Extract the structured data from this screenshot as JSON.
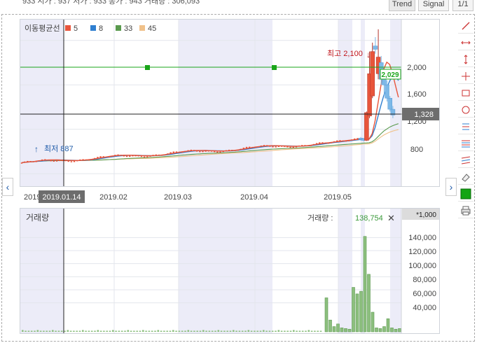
{
  "topbar": {
    "stats": "933   시가 : 937   저가 : 933   종가 : 943   거래량 : 306,093",
    "buttons": [
      "Trend",
      "Signal",
      "1/1"
    ]
  },
  "ma_legend": {
    "title": "이동평균선",
    "items": [
      {
        "label": "5",
        "color": "#e8553b"
      },
      {
        "label": "8",
        "color": "#2f7fd0"
      },
      {
        "label": "33",
        "color": "#5a9a4e"
      },
      {
        "label": "45",
        "color": "#f0c18a"
      }
    ]
  },
  "price_chart": {
    "high_label": "최고 2,100",
    "low_label": "최저 887",
    "current_price": "1,328",
    "green_flag": "2,029",
    "y_ticks": [
      "2,000",
      "1,600",
      "1,200",
      "800"
    ],
    "x_ticks": [
      "2019.0",
      "2019.02",
      "2019.03",
      "2019.04",
      "2019.05"
    ],
    "crosshair_date": "2019.01.14"
  },
  "volume_chart": {
    "title": "거래량",
    "readout_label": "거래량 :",
    "readout_value": "138,754",
    "close_symbol": "✕",
    "unit": "*1,000",
    "y_ticks": [
      "140,000",
      "120,000",
      "100,000",
      "80,000",
      "60,000",
      "40,000"
    ]
  },
  "nav": {
    "left": "‹",
    "right": "›"
  },
  "tools": [
    "line-tool",
    "horizontal-range-tool",
    "vertical-range-tool",
    "crosshair-tool",
    "rectangle-tool",
    "circle-tool",
    "text-lines-tool",
    "fibonacci-tool",
    "channel-tool",
    "eraser-tool",
    "color-tool",
    "print-tool"
  ],
  "colors": {
    "up": "#e8553b",
    "down": "#7db9e8",
    "accent_green": "#1aa51a"
  },
  "chart_data": {
    "type": "candlestick",
    "price": {
      "ylim": [
        700,
        2200
      ],
      "high": 2100,
      "low": 887,
      "current": 1328,
      "candles_recent": [
        {
          "o": 1120,
          "h": 1130,
          "l": 1095,
          "c": 1110
        },
        {
          "o": 1115,
          "h": 1120,
          "l": 1090,
          "c": 1100
        },
        {
          "o": 1100,
          "h": 1360,
          "l": 1095,
          "c": 1350
        },
        {
          "o": 1320,
          "h": 1900,
          "l": 1300,
          "c": 1700
        },
        {
          "o": 1500,
          "h": 1980,
          "l": 1480,
          "c": 1900
        },
        {
          "o": 1950,
          "h": 2030,
          "l": 1880,
          "c": 1920
        },
        {
          "o": 1700,
          "h": 2100,
          "l": 1650,
          "c": 1850
        },
        {
          "o": 1800,
          "h": 1860,
          "l": 1600,
          "c": 1650
        },
        {
          "o": 1650,
          "h": 1720,
          "l": 1500,
          "c": 1600
        },
        {
          "o": 1600,
          "h": 1640,
          "l": 1450,
          "c": 1480
        },
        {
          "o": 1480,
          "h": 1500,
          "l": 1360,
          "c": 1380
        },
        {
          "o": 1380,
          "h": 1410,
          "l": 1300,
          "c": 1328
        }
      ]
    },
    "volume": {
      "unit": "*1,000",
      "ylim": [
        0,
        150000
      ],
      "values_recent": [
        52000,
        18000,
        8000,
        12000,
        6000,
        5000,
        4000,
        68000,
        58000,
        62000,
        146000,
        88000,
        30000,
        6000,
        5000,
        8000,
        20000,
        6000,
        4000,
        5000
      ]
    }
  }
}
